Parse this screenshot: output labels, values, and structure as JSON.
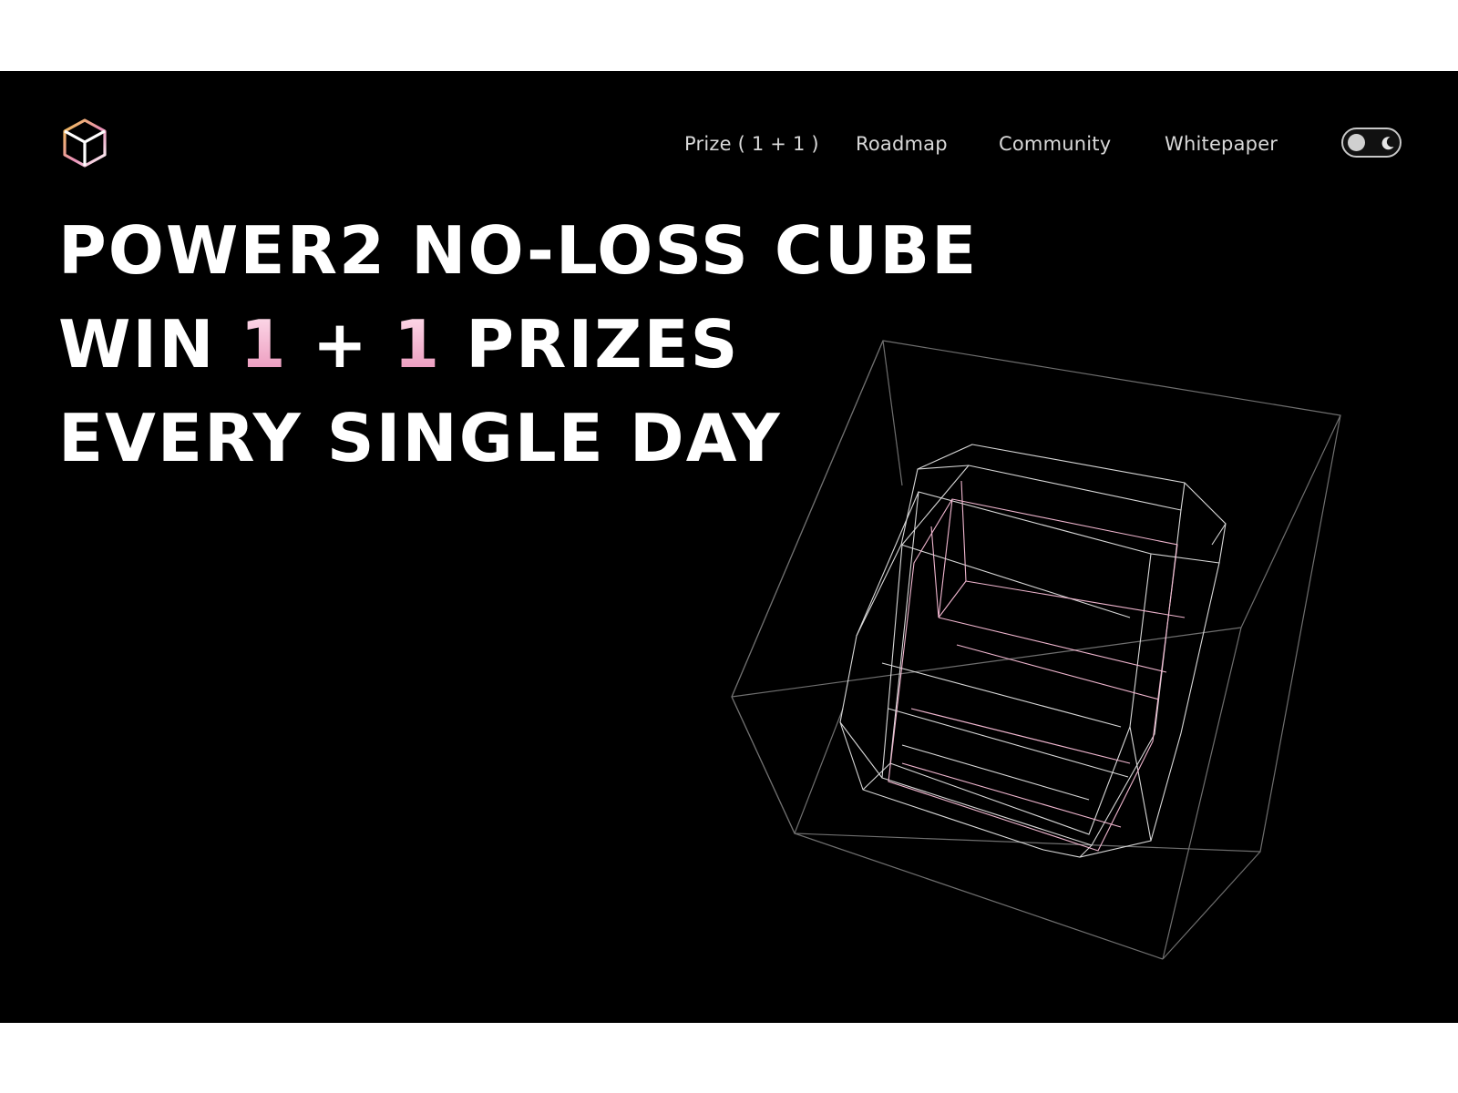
{
  "brand": {
    "logo_icon": "cube-logo-icon",
    "logo_colors": [
      "#f2c14e",
      "#e98fb6",
      "#ffffff"
    ]
  },
  "nav": {
    "items": [
      {
        "label": "Prize ( 1 + 1 )"
      },
      {
        "label": "Roadmap"
      },
      {
        "label": "Community"
      },
      {
        "label": "Whitepaper"
      }
    ]
  },
  "theme_toggle": {
    "icon": "moon-icon",
    "state": "light-knob-left"
  },
  "hero": {
    "line1": "POWER2 NO-LOSS CUBE",
    "line2_prefix": "WIN ",
    "line2_num1": "1",
    "line2_plus": " + ",
    "line2_num2": "1",
    "line2_suffix": " PRIZES",
    "line3": "EVERY SINGLE DAY"
  },
  "colors": {
    "background": "#000000",
    "text": "#ffffff",
    "accent_pink": "#e98fb6",
    "wire_outer": "#7a7a7a",
    "wire_inner_pink": "#f0b6cf"
  },
  "illustration": {
    "name": "wireframe-cube",
    "description_icon": "wireframe-cube-illustration"
  }
}
